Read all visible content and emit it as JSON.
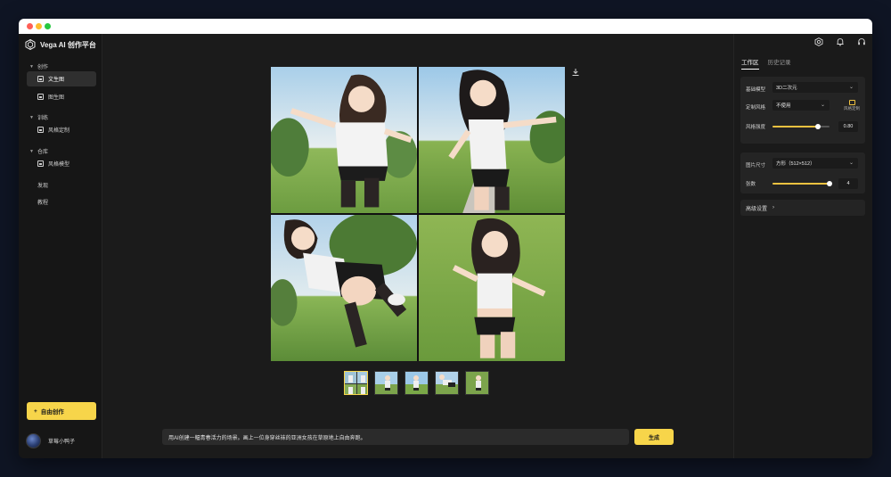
{
  "app": {
    "title": "Vega AI 创作平台"
  },
  "sidebar": {
    "sections": [
      {
        "label": "创作",
        "items": [
          {
            "label": "文生图",
            "active": true
          },
          {
            "label": "图生图",
            "active": false
          }
        ]
      },
      {
        "label": "训练",
        "items": [
          {
            "label": "风格定制",
            "active": false
          }
        ]
      },
      {
        "label": "仓库",
        "items": [
          {
            "label": "风格模型",
            "active": false
          }
        ]
      }
    ],
    "links": [
      "发现",
      "教程"
    ],
    "create_button": "自由创作",
    "user_name": "草莓小鸭子"
  },
  "header_icons": [
    "settings-icon",
    "bell-icon",
    "headset-icon"
  ],
  "tabs": [
    {
      "label": "工作区",
      "active": true
    },
    {
      "label": "历史记录",
      "active": false
    }
  ],
  "settings": {
    "base_model_label": "基础模型",
    "base_model_value": "3D二次元",
    "style_label": "定制风格",
    "style_value": "不使用",
    "custom_style_button": "风格定制",
    "style_strength_label": "风格强度",
    "style_strength_value": "0.80",
    "style_strength_fraction": 0.8,
    "size_label": "图片尺寸",
    "size_value": "方形（512×512）",
    "count_label": "张数",
    "count_value": "4",
    "count_fraction": 1.0,
    "advanced_label": "高级设置"
  },
  "prompt": {
    "value": "用AI创建一幅青春活力的场景。画上一位身穿丝袜的亚洲女孩在草原地上自由奔跑。",
    "generate_label": "生成"
  },
  "colors": {
    "accent": "#f7d54a",
    "background": "#1a1a1a"
  }
}
